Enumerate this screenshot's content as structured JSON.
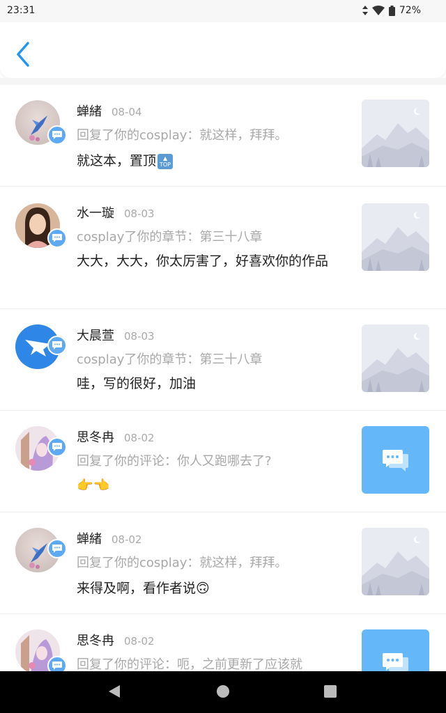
{
  "status": {
    "time": "23:31",
    "battery": "72%"
  },
  "header": {
    "back_icon": "chevron-left-icon",
    "accent": "#2196f3"
  },
  "messages": [
    {
      "name": "蝉緒",
      "date": "08-04",
      "subtitle": "回复了你的cosplay：就这样，拜拜。",
      "content": "就这本，置顶",
      "emoji": "top-icon",
      "thumb": "mountain-placeholder",
      "avatar": "bird-avatar"
    },
    {
      "name": "水一璇",
      "date": "08-03",
      "subtitle": "cosplay了你的章节：第三十八章",
      "content": "大大，大大，你太厉害了，好喜欢你的作品",
      "thumb": "mountain-placeholder",
      "avatar": "girl-avatar"
    },
    {
      "name": "大晨萱",
      "date": "08-03",
      "subtitle": "cosplay了你的章节：第三十八章",
      "content": "哇，写的很好，加油",
      "thumb": "mountain-placeholder",
      "avatar": "bird-logo-avatar"
    },
    {
      "name": "思冬冉",
      "date": "08-02",
      "subtitle": "回复了你的评论：你人又跑哪去了?",
      "content": "👉👈",
      "thumb": "chat-placeholder",
      "avatar": "anime-avatar"
    },
    {
      "name": "蝉緒",
      "date": "08-02",
      "subtitle": "回复了你的cosplay：就这样，拜拜。",
      "content": "来得及啊，看作者说🙃",
      "thumb": "mountain-placeholder",
      "avatar": "bird-avatar"
    },
    {
      "name": "思冬冉",
      "date": "08-02",
      "subtitle": "回复了你的评论：呃，之前更新了应该就",
      "content": "",
      "thumb": "chat-placeholder",
      "avatar": "anime-avatar"
    }
  ]
}
